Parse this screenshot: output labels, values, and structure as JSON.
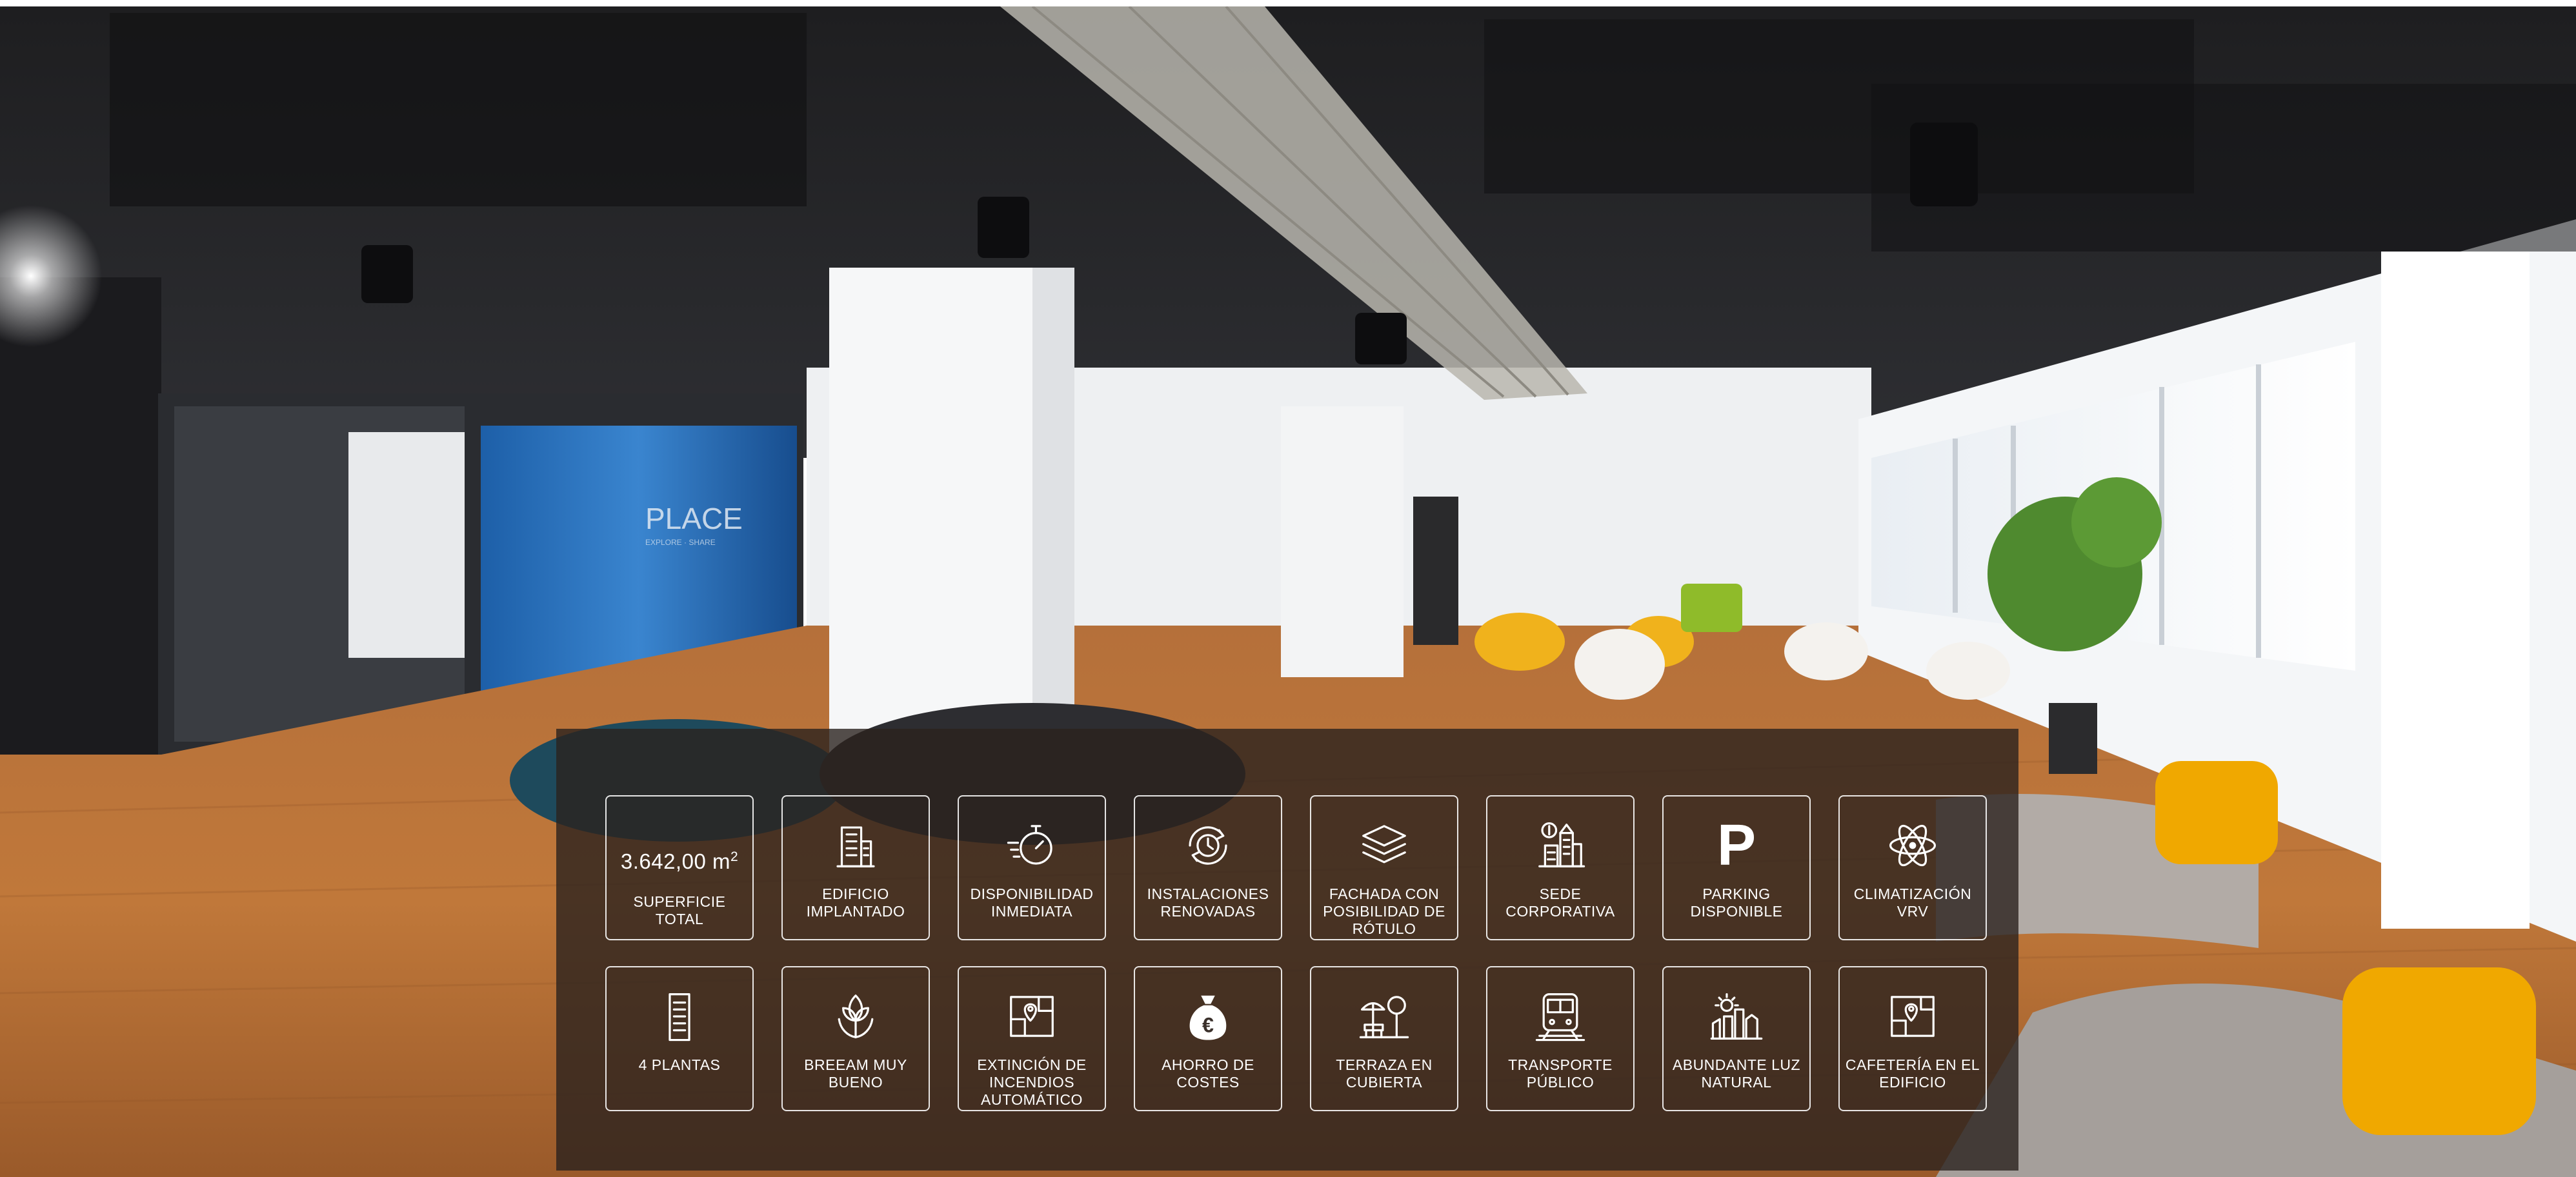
{
  "photo": {
    "signage": {
      "brand": "PLACE",
      "tagline": "EXPLORE · SHARE"
    }
  },
  "features": [
    {
      "icon": "area-icon",
      "value": "3.642,00 m",
      "unit_sup": "2",
      "label": "SUPERFICIE TOTAL"
    },
    {
      "icon": "building-icon",
      "label": "EDIFICIO IMPLANTADO"
    },
    {
      "icon": "stopwatch-icon",
      "label": "DISPONIBILIDAD INMEDIATA"
    },
    {
      "icon": "renovation-clock-icon",
      "label": "INSTALACIONES RENOVADAS"
    },
    {
      "icon": "facade-layers-icon",
      "label": "FACHADA CON POSIBILIDAD DE RÓTULO"
    },
    {
      "icon": "headquarters-icon",
      "label": "SEDE CORPORATIVA"
    },
    {
      "icon": "parking-icon",
      "label": "PARKING DISPONIBLE"
    },
    {
      "icon": "atom-icon",
      "label": "CLIMATIZACIÓN VRV"
    },
    {
      "icon": "floors-icon",
      "label": "4 PLANTAS"
    },
    {
      "icon": "leaf-hands-icon",
      "label": "BREEAM MUY BUENO"
    },
    {
      "icon": "floorplan-pin-icon",
      "label": "EXTINCIÓN DE INCENDIOS AUTOMÁTICO"
    },
    {
      "icon": "money-bag-icon",
      "label": "AHORRO DE COSTES",
      "symbol": "€"
    },
    {
      "icon": "terrace-icon",
      "label": "TERRAZA EN CUBIERTA"
    },
    {
      "icon": "train-icon",
      "label": "TRANSPORTE PÚBLICO"
    },
    {
      "icon": "sun-city-icon",
      "label": "ABUNDANTE LUZ NATURAL"
    },
    {
      "icon": "cafeteria-pin-icon",
      "label": "CAFETERÍA EN EL EDIFICIO"
    }
  ]
}
